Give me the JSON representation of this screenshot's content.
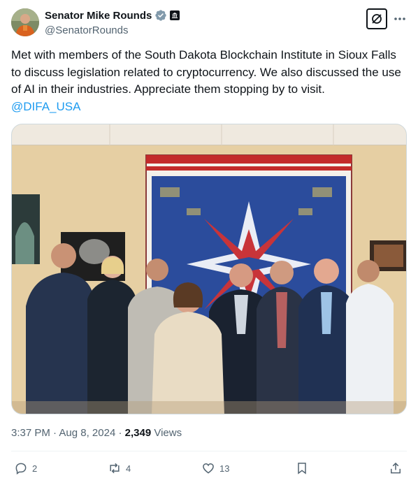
{
  "author": {
    "display_name": "Senator Mike Rounds",
    "handle": "@SenatorRounds",
    "avatar_icon": "senator-portrait-avatar",
    "verified_icon": "verified-badge-icon",
    "affiliation_icon": "government-badge-icon"
  },
  "header": {
    "grok_icon": "grok-icon",
    "more_icon": "more-icon"
  },
  "tweet": {
    "text": "Met with members of the South Dakota Blockchain Institute in Sioux Falls to discuss legislation related to cryptocurrency. We also discussed the use of AI in their industries. Appreciate them stopping by to visit.",
    "mention": "@DIFA_USA"
  },
  "meta": {
    "time": "3:37 PM",
    "separator1": "·",
    "date": "Aug 8, 2024",
    "separator2": "·",
    "views_count": "2,349",
    "views_label": "Views"
  },
  "actions": {
    "replies": "2",
    "reposts": "4",
    "likes": "13"
  },
  "colors": {
    "accent": "#1d9bf0",
    "verified": "#829aab",
    "text": "#0f1419",
    "secondary": "#536471"
  }
}
